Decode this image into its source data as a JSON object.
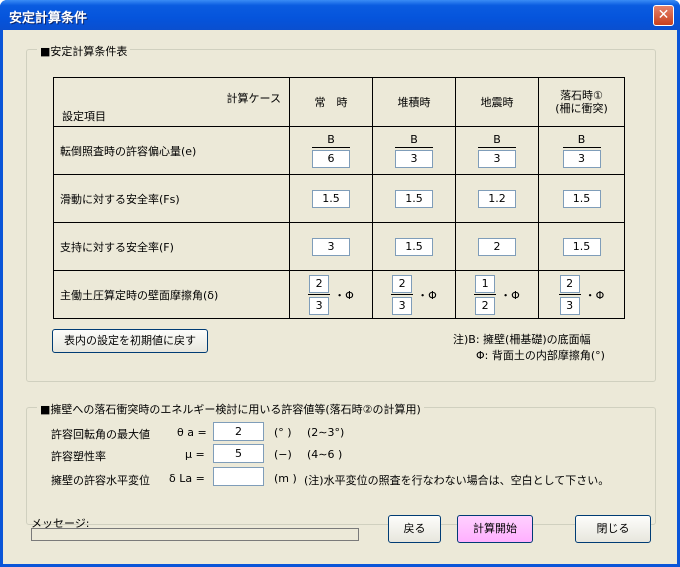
{
  "window": {
    "title": "安定計算条件",
    "close_glyph": "✕"
  },
  "table_group": {
    "label": "■安定計算条件表",
    "header": {
      "case_label": "計算ケース",
      "item_label": "設定項目",
      "columns": [
        "常　時",
        "堆積時",
        "地震時",
        "落石時①\n(柵に衝突)"
      ]
    },
    "rows": [
      {
        "label": "転倒照査時の許容偏心量(e)",
        "numerator": "B",
        "values": [
          "6",
          "3",
          "3",
          "3"
        ]
      },
      {
        "label": "滑動に対する安全率(Fs)",
        "values": [
          "1.5",
          "1.5",
          "1.2",
          "1.5"
        ]
      },
      {
        "label": "支持に対する安全率(F)",
        "values": [
          "3",
          "1.5",
          "2",
          "1.5"
        ]
      },
      {
        "label": "主働土圧算定時の壁面摩擦角(δ)",
        "phi": "・Φ",
        "fractions": [
          [
            "2",
            "3"
          ],
          [
            "2",
            "3"
          ],
          [
            "1",
            "2"
          ],
          [
            "2",
            "3"
          ]
        ]
      }
    ],
    "reset_button": "表内の設定を初期値に戻す",
    "note1": "注)B: 擁壁(柵基礎)の底面幅",
    "note2": "Φ: 背面土の内部摩擦角(°)"
  },
  "impact_group": {
    "label": "■擁壁への落石衝突時のエネルギー検討に用いる許容値等(落石時②の計算用)",
    "rows": [
      {
        "label": "許容回転角の最大値",
        "symbol": "θ a =",
        "value": "2",
        "unit": "(° )",
        "range": "(2∼3°)"
      },
      {
        "label": "許容塑性率",
        "symbol": "μ =",
        "value": "5",
        "unit": "(−)",
        "range": "(4∼6 )"
      },
      {
        "label": "擁壁の許容水平変位",
        "symbol": "δ La =",
        "value": "",
        "unit": "(m )",
        "range": "(注)水平変位の照査を行なわない場合は、空白として下さい。"
      }
    ]
  },
  "footer": {
    "message_label": "メッセージ:",
    "message_value": "",
    "back_button": "戻る",
    "calc_button": "計算開始",
    "close_button": "閉じる"
  }
}
